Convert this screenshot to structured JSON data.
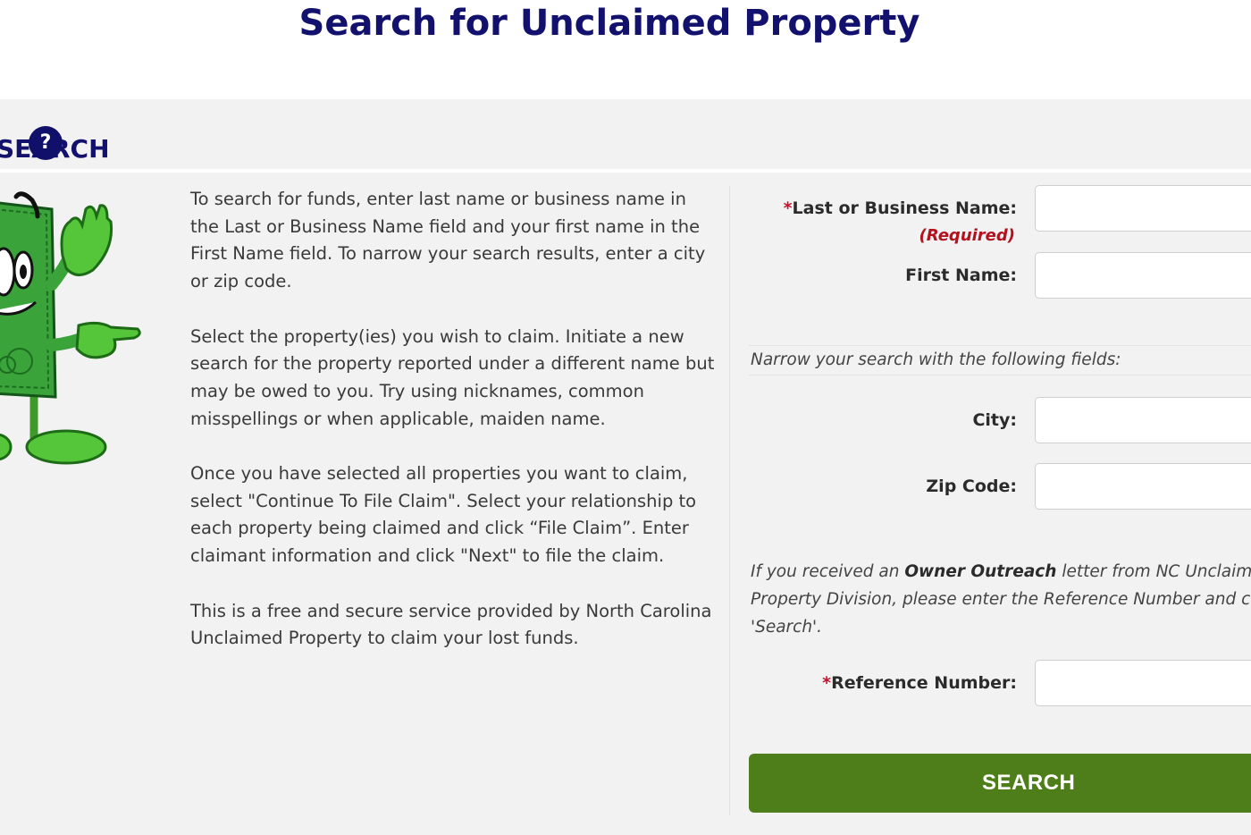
{
  "page": {
    "title": "Search for Unclaimed Property"
  },
  "section": {
    "heading": "SEARCH",
    "help_icon": "?"
  },
  "instructions": [
    "To search for funds, enter last name or business name in the Last or Business Name field and your first name in the First Name field. To narrow your search results, enter a city or zip code.",
    "Select the property(ies) you wish to claim. Initiate a new search for the property reported under a different name but may be owed to you. Try using nicknames, common misspellings or when applicable, maiden name.",
    "Once you have selected all properties you want to claim, select \"Continue To File Claim\". Select your relationship to each property being claimed and click “File Claim”. Enter claimant information and click \"Next\" to file the claim.",
    "This is a free and secure service provided by North Carolina Unclaimed Property to claim your lost funds."
  ],
  "form": {
    "last_name": {
      "star": "*",
      "label": "Last or Business Name:",
      "required_note": "(Required)",
      "value": ""
    },
    "first_name": {
      "label": "First Name:",
      "value": ""
    },
    "narrow_note": "Narrow your search with the following fields:",
    "city": {
      "label": "City:",
      "value": ""
    },
    "zip": {
      "label": "Zip Code:",
      "value": ""
    },
    "outreach": {
      "prefix": "If you received an ",
      "emphasis": "Owner Outreach",
      "suffix": " letter from NC Unclaimed Property Division, please enter the Reference Number and click 'Search'."
    },
    "reference": {
      "star": "*",
      "label": "Reference Number:",
      "value": ""
    },
    "search_label": "SEARCH"
  },
  "colors": {
    "title": "#12126e",
    "button": "#4e7e1a",
    "required": "#b3121e",
    "panel": "#f2f2f2"
  },
  "icons": {
    "help": "question-circle-icon",
    "mascot": "dollar-bill-mascot-icon"
  }
}
